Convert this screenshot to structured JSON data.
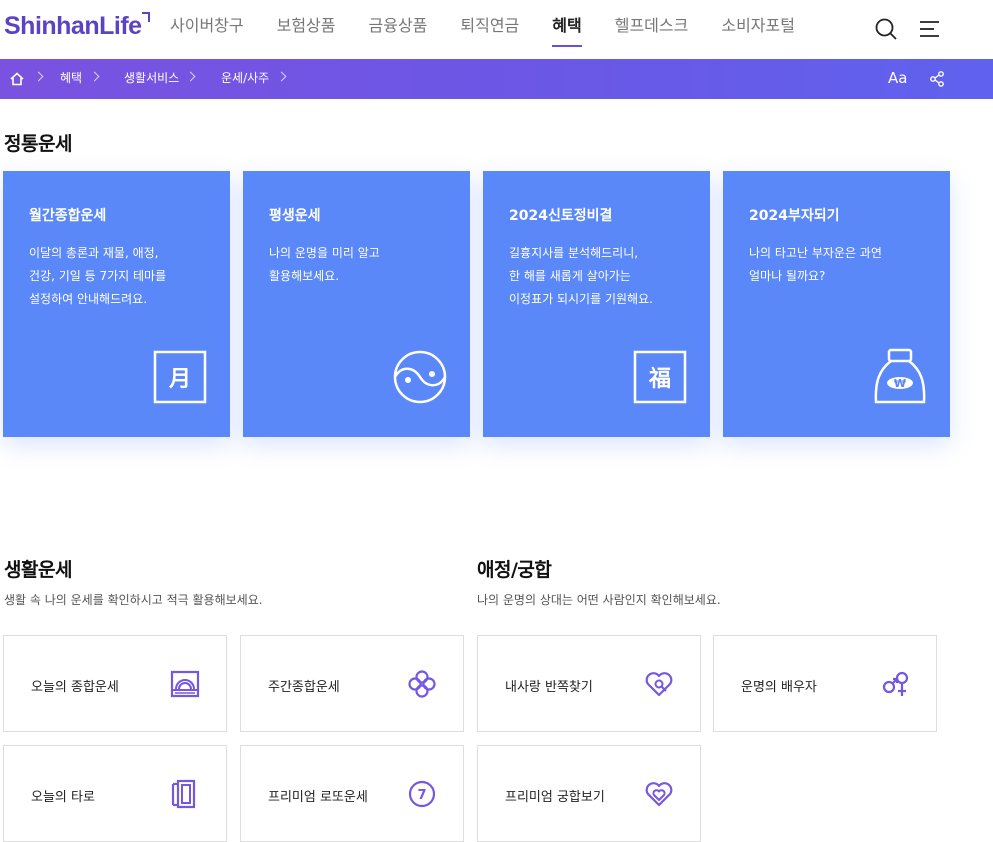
{
  "header": {
    "logo_text": "ShinhanLife",
    "nav": [
      "사이버창구",
      "보험상품",
      "금융상품",
      "퇴직연금",
      "혜택",
      "헬프데스크",
      "소비자포털"
    ],
    "active_nav": "혜택",
    "brand_color": "#5b43c4"
  },
  "breadcrumb": {
    "items": [
      "혜택",
      "생활서비스",
      "운세/사주"
    ],
    "font_size_icon": "Aa",
    "bar_color": "#6b57e6"
  },
  "fortune": {
    "title": "정통운세",
    "cards": [
      {
        "title": "월간종합운세",
        "desc": "이달의 총론과 재물, 애정,\n건강, 기일 등 7가지 테마를\n설정하여 안내해드려요.",
        "icon": "moon-char-icon",
        "icon_char": "月"
      },
      {
        "title": "평생운세",
        "desc": "나의 운명을 미리 알고\n활용해보세요.",
        "icon": "yin-yang-icon"
      },
      {
        "title": "2024신토정비결",
        "desc": "길흉지사를 분석해드리니,\n한 해를 새롭게 살아가는\n이정표가 되시기를 기원해요.",
        "icon": "fortune-char-icon",
        "icon_char": "福"
      },
      {
        "title": "2024부자되기",
        "desc": "나의 타고난 부자운은 과연\n얼마나 될까요?",
        "icon": "money-bag-icon",
        "icon_char": "₩"
      }
    ],
    "card_color": "#5b88f9"
  },
  "life": {
    "title": "생활운세",
    "desc": "생활 속 나의 운세를 확인하시고 적극 활용해보세요.",
    "items": [
      {
        "label": "오늘의 종합운세",
        "icon": "sunrise-icon"
      },
      {
        "label": "주간종합운세",
        "icon": "clover-icon"
      },
      {
        "label": "오늘의 타로",
        "icon": "tarot-cards-icon"
      },
      {
        "label": "프리미엄 로또운세",
        "icon": "lucky-seven-icon",
        "icon_char": "7"
      }
    ]
  },
  "love": {
    "title": "애정/궁합",
    "desc": "나의 운명의 상대는 어떤 사람인지 확인해보세요.",
    "items": [
      {
        "label": "내사랑 반쪽찾기",
        "icon": "heart-search-icon"
      },
      {
        "label": "운명의 배우자",
        "icon": "gender-symbols-icon"
      },
      {
        "label": "프리미엄 궁합보기",
        "icon": "double-heart-icon"
      }
    ]
  },
  "accent_color": "#7557e0"
}
